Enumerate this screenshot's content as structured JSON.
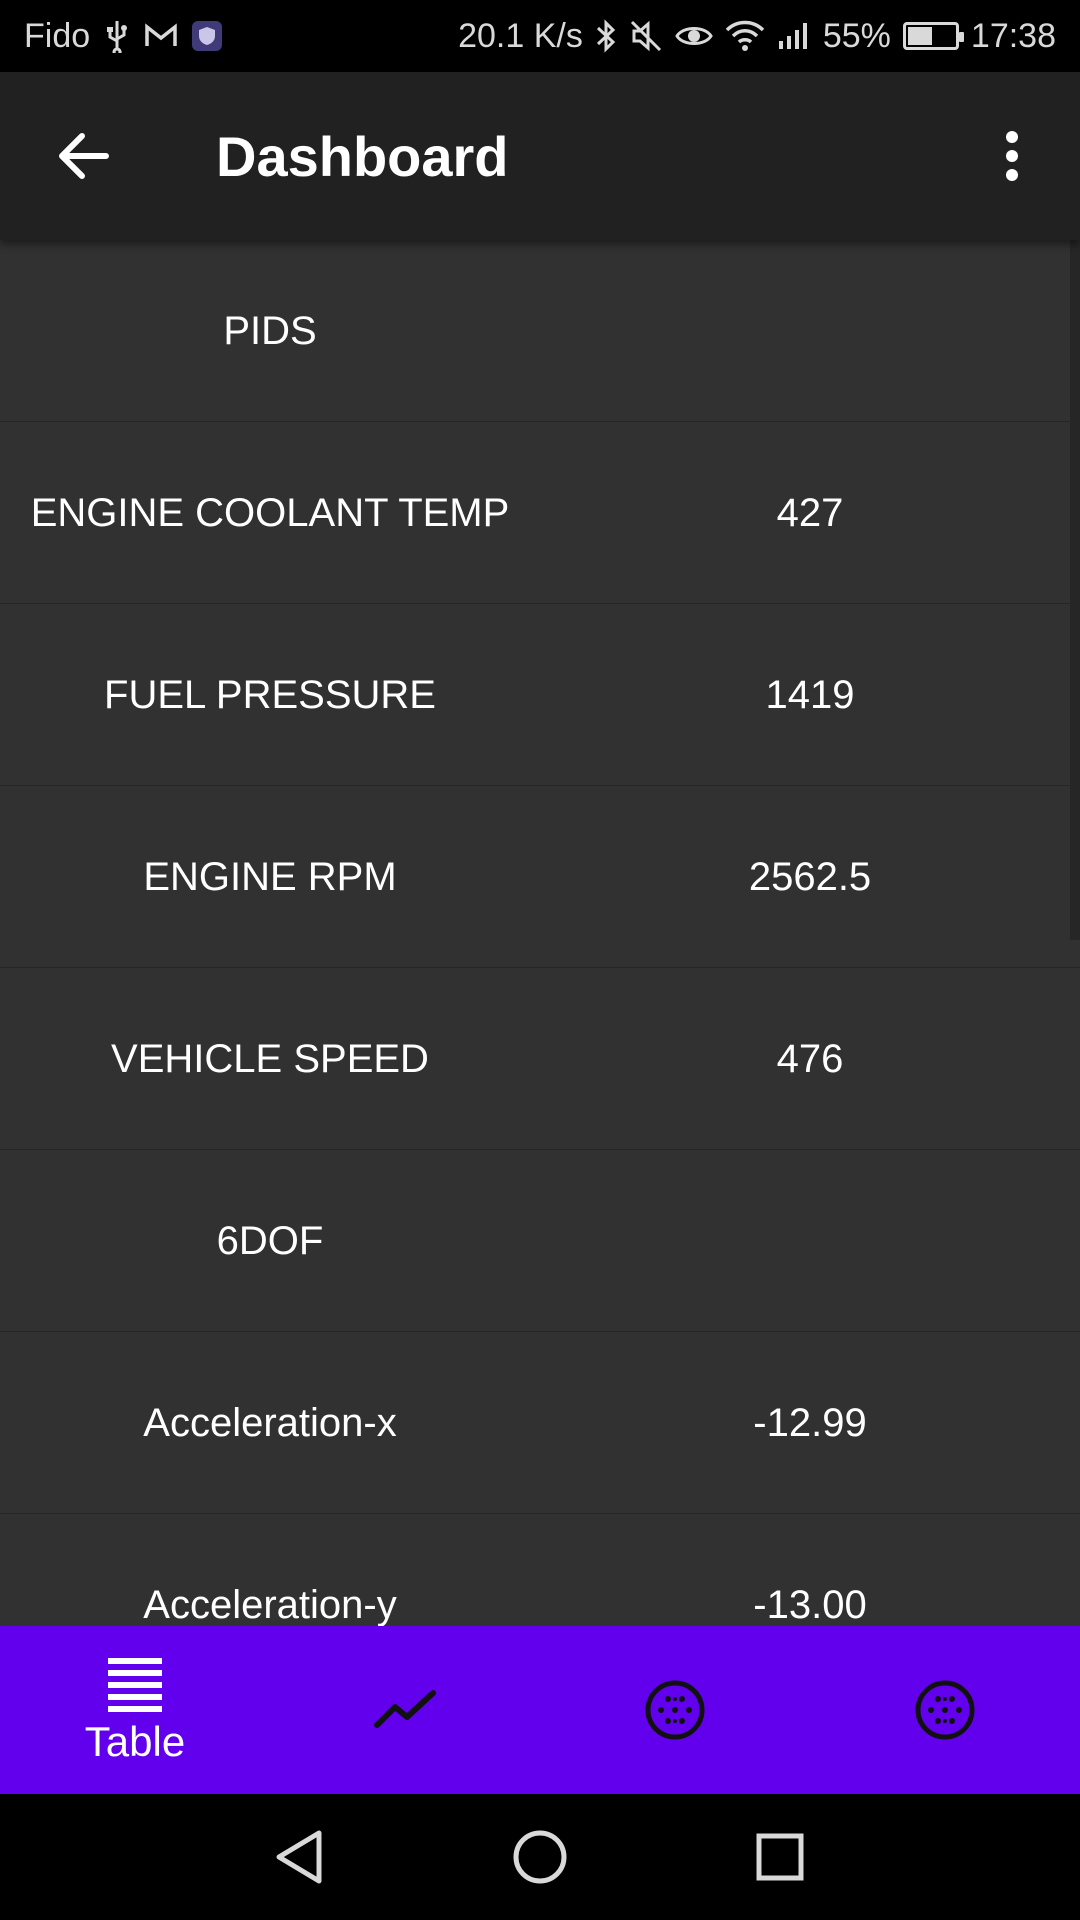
{
  "status_bar": {
    "carrier": "Fido",
    "net_speed": "20.1 K/s",
    "battery": "55%",
    "time": "17:38",
    "battery_level": 0.55
  },
  "app_bar": {
    "title": "Dashboard",
    "back_icon": "arrow-back-icon",
    "menu_icon": "more-vert-icon"
  },
  "table": {
    "rows": [
      {
        "name": "PIDS",
        "value": ""
      },
      {
        "name": "ENGINE COOLANT TEMP",
        "value": "427"
      },
      {
        "name": "FUEL PRESSURE",
        "value": "1419"
      },
      {
        "name": "ENGINE RPM",
        "value": "2562.5"
      },
      {
        "name": "VEHICLE SPEED",
        "value": "476"
      },
      {
        "name": "6DOF",
        "value": ""
      },
      {
        "name": "Acceleration-x",
        "value": "-12.99"
      },
      {
        "name": "Acceleration-y",
        "value": "-13.00"
      }
    ]
  },
  "bottom_nav": {
    "items": [
      {
        "label": "Table",
        "icon": "table-list-icon",
        "active": true
      },
      {
        "label": "",
        "icon": "chart-line-icon",
        "active": false
      },
      {
        "label": "",
        "icon": "gauge-dots-icon",
        "active": false
      },
      {
        "label": "",
        "icon": "gauge-dots-icon",
        "active": false
      }
    ]
  },
  "colors": {
    "accent": "#6200ee",
    "background": "#313131",
    "app_bar": "#212121",
    "status_bar": "#000000",
    "text": "#ffffff"
  }
}
